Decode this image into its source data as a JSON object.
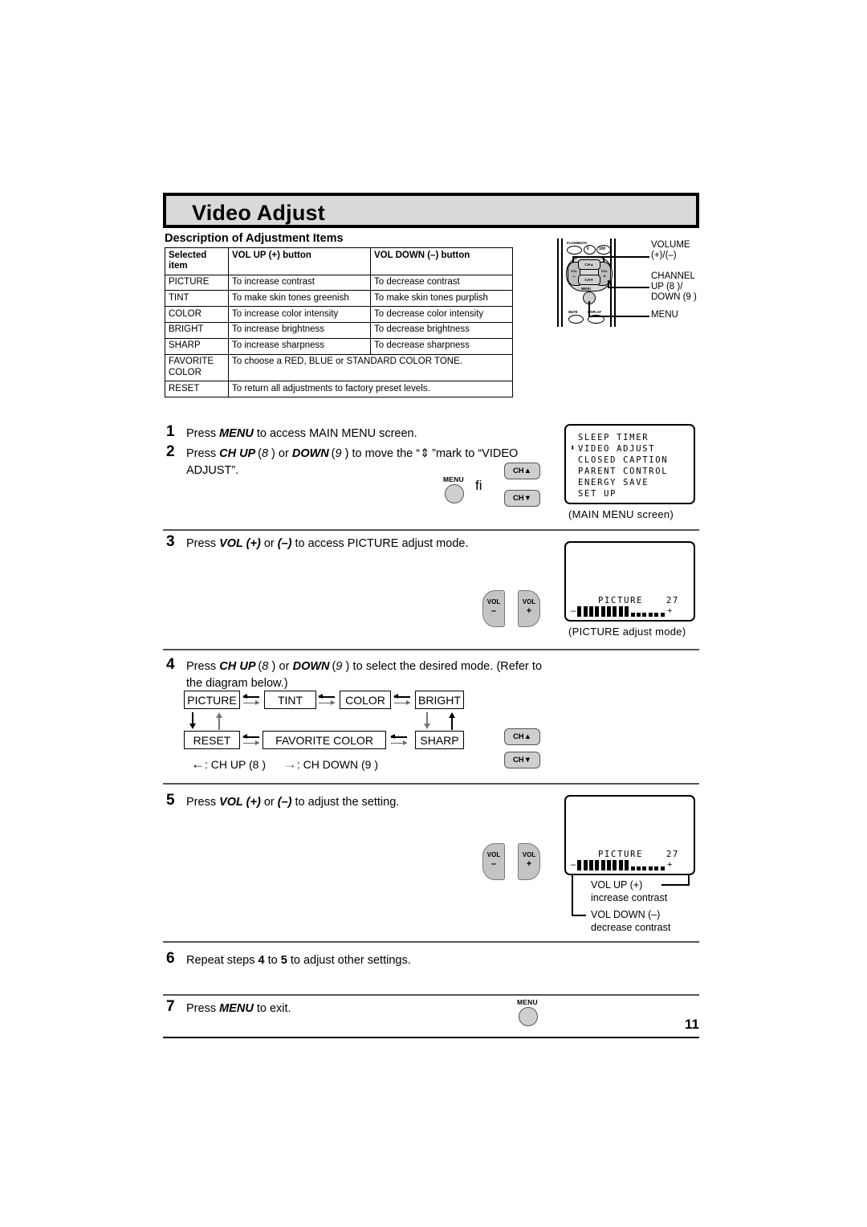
{
  "page": {
    "title": "Video Adjust",
    "subheading": "Description of Adjustment Items",
    "page_number": "11"
  },
  "table": {
    "headers": [
      "Selected item",
      "VOL UP (+) button",
      "VOL DOWN (–) button"
    ],
    "header_col1_line1": "Selected",
    "header_col1_line2": "item",
    "rows": [
      {
        "item": "PICTURE",
        "up": "To increase contrast",
        "down": "To decrease contrast",
        "span": false
      },
      {
        "item": "TINT",
        "up": "To make skin tones greenish",
        "down": "To make skin tones purplish",
        "span": false
      },
      {
        "item": "COLOR",
        "up": "To increase color intensity",
        "down": "To decrease color intensity",
        "span": false
      },
      {
        "item": "BRIGHT",
        "up": "To increase brightness",
        "down": "To decrease brightness",
        "span": false
      },
      {
        "item": "SHARP",
        "up": "To increase sharpness",
        "down": "To decrease sharpness",
        "span": false
      },
      {
        "item": "FAVORITE COLOR",
        "item_line1": "FAVORITE",
        "item_line2": "COLOR",
        "up": "To choose a RED, BLUE or STANDARD COLOR TONE.",
        "down": "",
        "span": true
      },
      {
        "item": "RESET",
        "up": "To return all adjustments to factory preset levels.",
        "down": "",
        "span": true
      }
    ]
  },
  "remote": {
    "buttons": {
      "flashback": "FLASHBACK",
      "zero": "0",
      "hundred": "100",
      "vol_minus_l1": "VOL",
      "vol_minus_l2": "–",
      "vol_plus_l1": "VOL",
      "vol_plus_l2": "+",
      "ch_up": "CH▲",
      "ch_down": "CH▼",
      "menu": "MENU",
      "mute": "MUTE",
      "display": "DISPLAY"
    },
    "callouts": [
      {
        "line1": "VOLUME",
        "line2": "(+)/(–)",
        "line3": ""
      },
      {
        "line1": "CHANNEL",
        "line2": "UP (8 )/",
        "line3": "DOWN (9 )"
      },
      {
        "line1": "MENU",
        "line2": "",
        "line3": ""
      }
    ]
  },
  "steps": [
    {
      "num": "1",
      "text_html": "Press <i>MENU</i> to access MAIN MENU screen."
    },
    {
      "num": "2",
      "text_html": "Press <i>CH UP</i> (<em>8</em> ) or <i>DOWN</i> (<em>9</em> ) to move the “ ⬍ ” mark to “VIDEO ADJUST”."
    },
    {
      "num": "3",
      "text_html": "Press <i>VOL (+)</i> or <i>(–)</i> to access PICTURE adjust mode."
    },
    {
      "num": "4",
      "text_html": "Press <i>CH UP</i> (<em>8</em> ) or <i>DOWN</i> (<em>9</em> ) to select the desired mode. (Refer to the diagram below.)"
    },
    {
      "num": "5",
      "text_html": "Press <i>VOL (+)</i> or <i>(–)</i> to adjust the setting."
    },
    {
      "num": "6",
      "text_html": "Repeat steps <b>4</b> to <b>5</b> to adjust other settings."
    },
    {
      "num": "7",
      "text_html": "Press <i>MENU</i> to exit."
    }
  ],
  "main_menu_screen": {
    "cursor_mark": "⬍",
    "items": [
      "SLEEP TIMER",
      "VIDEO ADJUST",
      "CLOSED CAPTION",
      "PARENT CONTROL",
      "ENERGY SAVE",
      "SET UP"
    ],
    "selected_index": 1,
    "caption": "(MAIN MENU screen)"
  },
  "picture_screen_step3": {
    "label": "PICTURE",
    "value": "27",
    "minus_sign": "–",
    "plus_sign": "+",
    "filled_bars": 9,
    "empty_bars": 6,
    "caption": "(PICTURE adjust mode)"
  },
  "picture_screen_step5": {
    "label": "PICTURE",
    "value": "27",
    "minus_sign": "–",
    "plus_sign": "+",
    "filled_bars": 9,
    "empty_bars": 6,
    "callout_up_l1": "VOL UP (+)",
    "callout_up_l2": "increase contrast",
    "callout_down_l1": "VOL DOWN (–)",
    "callout_down_l2": "decrease contrast"
  },
  "mode_diagram": {
    "row1": [
      "PICTURE",
      "TINT",
      "COLOR",
      "BRIGHT"
    ],
    "row2": [
      "RESET",
      "FAVORITE COLOR",
      "SHARP"
    ],
    "legend_left": ": CH UP (8 )",
    "legend_right": ": CH DOWN (9 )"
  },
  "keys": {
    "menu_label": "MENU",
    "ch_up_label": "CH▲",
    "ch_down_label": "CH▼",
    "vol_label": "VOL",
    "vol_minus": "–",
    "vol_plus": "+",
    "arrow_glyph": "fi"
  },
  "colors": {
    "title_bg": "#d9d9d9",
    "key_gray": "#cfcfcf",
    "rule": "#555555"
  }
}
